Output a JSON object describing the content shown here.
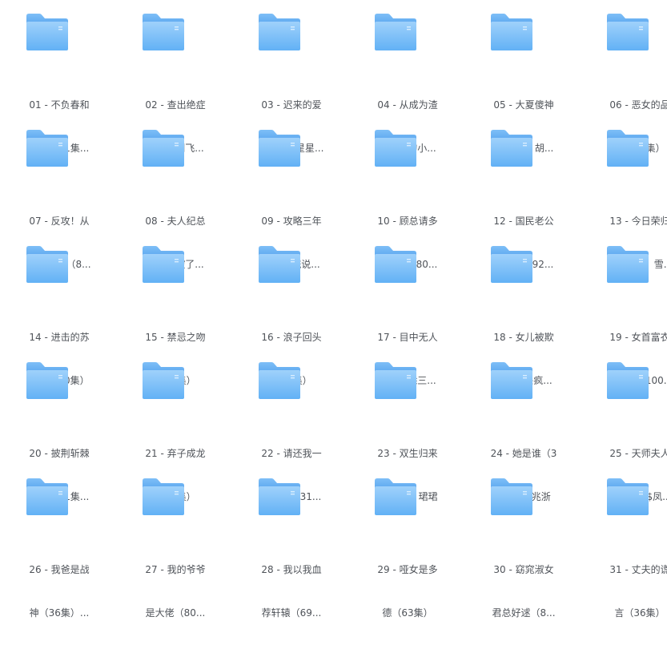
{
  "folders": [
    {
      "line1": "01 - 不负春和",
      "line2": "景宁（81集..."
    },
    {
      "line1": "02 - 查出绝症",
      "line2": "后，我创飞..."
    },
    {
      "line1": "03 - 迟来的爱",
      "line2": "&天上的星星..."
    },
    {
      "line1": "04 - 从成为渣",
      "line2": "男前任的小..."
    },
    {
      "line1": "05 - 大夏傻神",
      "line2": "（82集）胡..."
    },
    {
      "line1": "06 - 恶女的品",
      "line2": "格（77集）"
    },
    {
      "line1": "07 - 反攻！从",
      "line2": "顶流做起（8..."
    },
    {
      "line1": "08 - 夫人纪总",
      "line2": "他又失控了..."
    },
    {
      "line1": "09 - 攻略三年",
      "line2": "半，系统说..."
    },
    {
      "line1": "10 - 顾总请多",
      "line2": "多指教（80..."
    },
    {
      "line1": "12 - 国民老公",
      "line2": "带回家（92..."
    },
    {
      "line1": "13 - 今日荣归",
      "line2": "（100集）雪..."
    },
    {
      "line1": "14 - 进击的苏",
      "line2": "夫人（80集）"
    },
    {
      "line1": "15 - 禁忌之吻",
      "line2": "（99集）"
    },
    {
      "line1": "16 - 浪子回头",
      "line2": "（80集）"
    },
    {
      "line1": "17 - 目中无人",
      "line2": "之盲龙除三..."
    },
    {
      "line1": "18 - 女儿被欺",
      "line2": "负后我杀疯..."
    },
    {
      "line1": "19 - 女首富衣",
      "line2": "锦还乡（100..."
    },
    {
      "line1": "20 - 披荆斩棘",
      "line2": "的她（91集..."
    },
    {
      "line1": "21 - 弃子成龙",
      "line2": "（89集）"
    },
    {
      "line1": "22 - 请还我一",
      "line2": "个清白（31..."
    },
    {
      "line1": "23 - 双生归来",
      "line2": "（58集）珺珺"
    },
    {
      "line1": "24 - 她是谁（3",
      "line2": "5集）张兆浙"
    },
    {
      "line1": "25 - 天师夫人",
      "line2": "又美又飒$凤..."
    },
    {
      "line1": "26 - 我爸是战",
      "line2": "神（36集）..."
    },
    {
      "line1": "27 - 我的爷爷",
      "line2": "是大佬（80..."
    },
    {
      "line1": "28 - 我以我血",
      "line2": "荐轩辕（69..."
    },
    {
      "line1": "29 - 哑女是多",
      "line2": "德（63集）"
    },
    {
      "line1": "30 - 窈窕淑女",
      "line2": "君总好逑（8..."
    },
    {
      "line1": "31 - 丈夫的谎",
      "line2": "言（36集）"
    }
  ],
  "icons": {
    "folder": "folder-icon"
  }
}
